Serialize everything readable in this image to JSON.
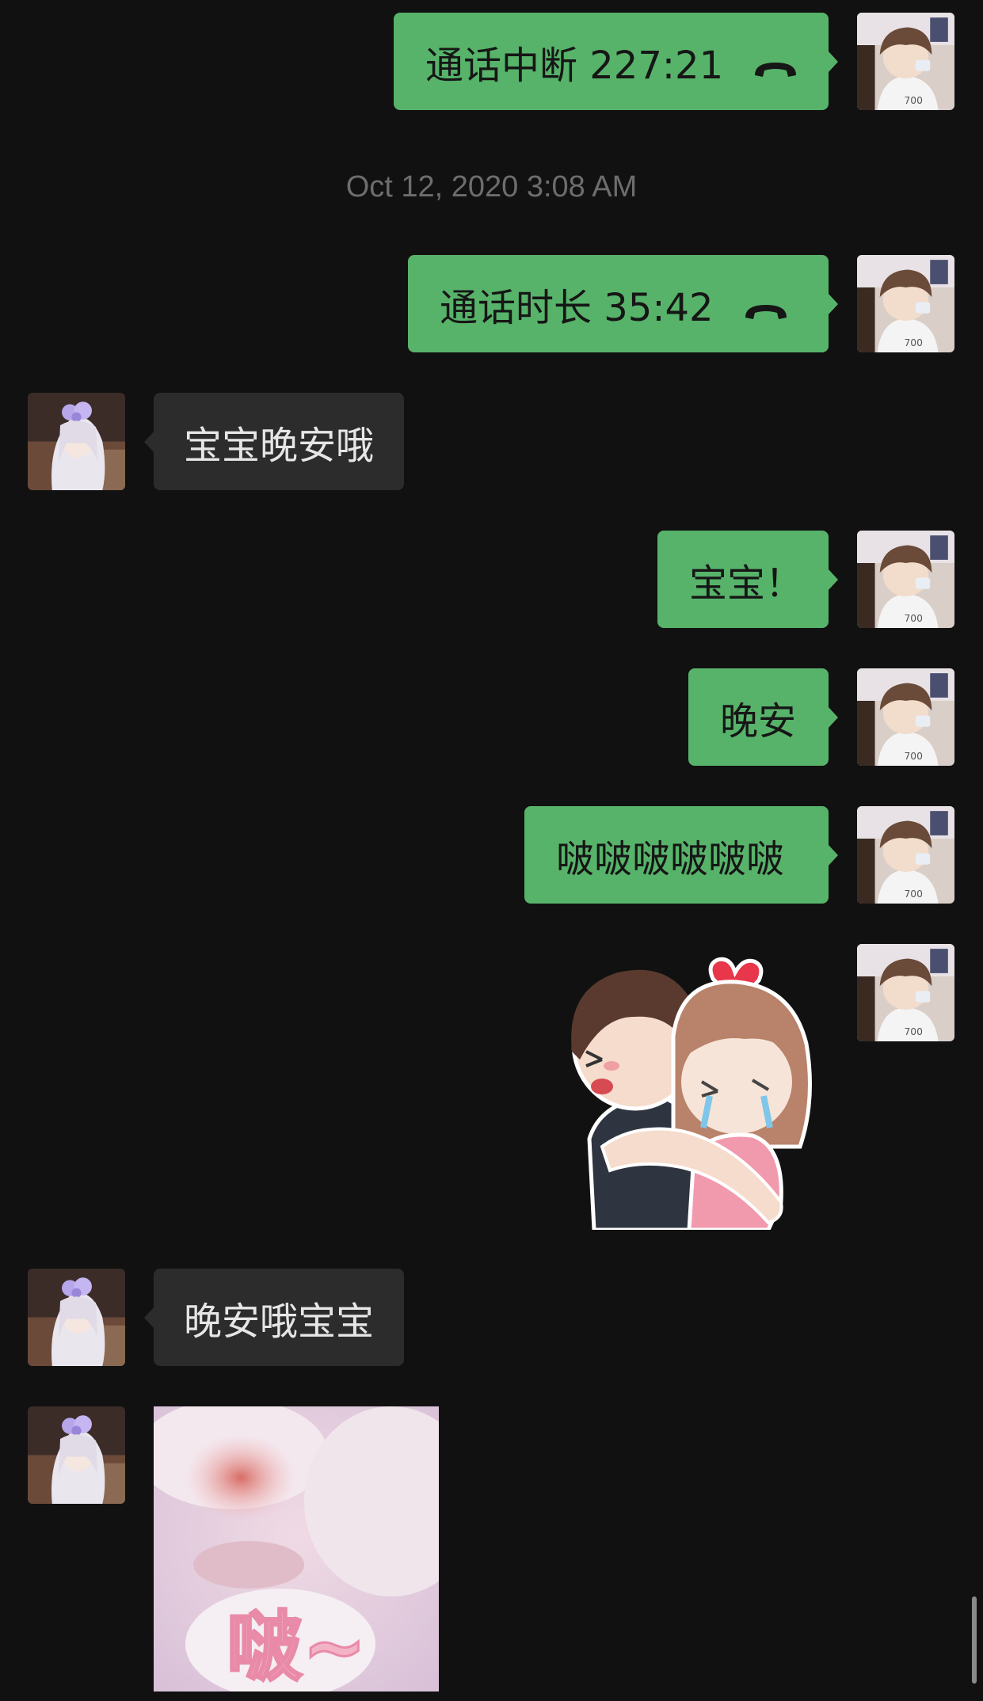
{
  "chat": {
    "timestamp": "Oct 12, 2020 3:08 AM",
    "messages": [
      {
        "id": "m1",
        "sender": "me",
        "type": "call",
        "text": "通话中断 227:21",
        "icon": "phone-hangup-icon"
      },
      {
        "id": "m2",
        "sender": "me",
        "type": "call",
        "text": "通话时长 35:42",
        "icon": "phone-hangup-icon"
      },
      {
        "id": "m3",
        "sender": "other",
        "type": "text",
        "text": "宝宝晚安哦"
      },
      {
        "id": "m4",
        "sender": "me",
        "type": "text",
        "text": "宝宝！"
      },
      {
        "id": "m5",
        "sender": "me",
        "type": "text",
        "text": "晚安"
      },
      {
        "id": "m6",
        "sender": "me",
        "type": "text",
        "text": "啵啵啵啵啵啵"
      },
      {
        "id": "m7",
        "sender": "me",
        "type": "sticker",
        "sticker": "hugging-couple-sticker"
      },
      {
        "id": "m8",
        "sender": "other",
        "type": "text",
        "text": "晚安哦宝宝"
      },
      {
        "id": "m9",
        "sender": "other",
        "type": "sticker",
        "sticker": "bunny-kiss-sticker",
        "caption": "啵~"
      }
    ]
  },
  "colors": {
    "background": "#111111",
    "outgoing_bubble": "#57b36a",
    "incoming_bubble": "#2c2c2c",
    "timestamp_text": "#6d6d6d"
  },
  "icons": {
    "call": "phone-hangup-icon",
    "my_avatar": "boy-avatar",
    "their_avatar": "girl-avatar"
  }
}
